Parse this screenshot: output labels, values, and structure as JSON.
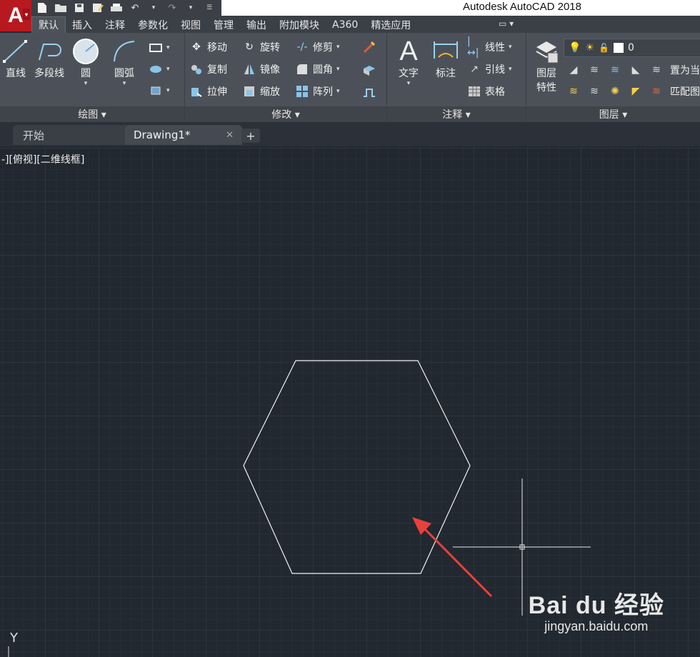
{
  "app": {
    "title": "Autodesk AutoCAD 2018",
    "logo_letter": "A"
  },
  "ribbon_tabs": [
    "默认",
    "插入",
    "注释",
    "参数化",
    "视图",
    "管理",
    "输出",
    "附加模块",
    "A360",
    "精选应用"
  ],
  "ribbon_tab_extra": "▭ ▾",
  "panels": {
    "draw": {
      "title": "绘图 ▾",
      "line": "直线",
      "polyline": "多段线",
      "circle": "圆",
      "arc": "圆弧"
    },
    "modify": {
      "title": "修改 ▾",
      "move": "移动",
      "rotate": "旋转",
      "trim": "修剪",
      "copy": "复制",
      "mirror": "镜像",
      "fillet": "圆角",
      "stretch": "拉伸",
      "scale": "缩放",
      "array": "阵列"
    },
    "annotation": {
      "title": "注释 ▾",
      "text": "文字",
      "dimension": "标注",
      "linear": "线性",
      "leader": "引线",
      "table": "表格"
    },
    "layers": {
      "title": "图层 ▾",
      "properties_line1": "图层",
      "properties_line2": "特性",
      "current_layer": "0",
      "set_current": "置为当",
      "match": "匹配图"
    }
  },
  "doc_tabs": {
    "start": "开始",
    "drawing": "Drawing1*",
    "close": "✕",
    "plus": "+"
  },
  "viewport": {
    "label": "-][俯视][二维线框]",
    "ucs_y": "Y"
  },
  "watermark": {
    "logo": "Bai du 经验",
    "url": "jingyan.baidu.com"
  },
  "colors": {
    "accent": "#b8191f",
    "canvas": "#212830",
    "annotation_arrow": "#e8413c"
  }
}
